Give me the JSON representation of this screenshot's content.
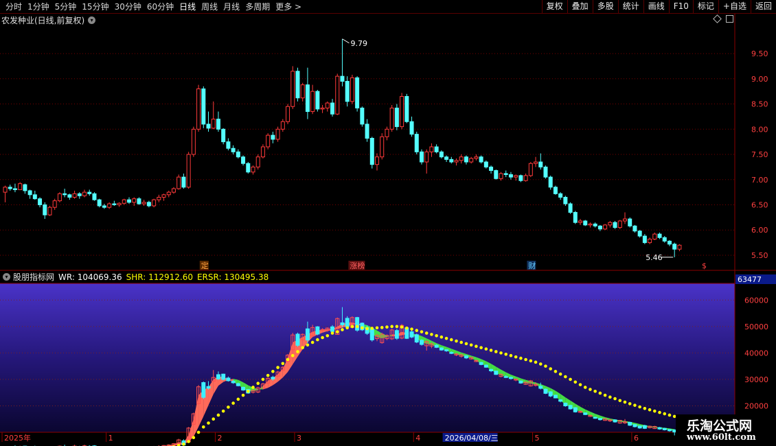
{
  "toolbar": {
    "periods": [
      "分时",
      "1分钟",
      "5分钟",
      "15分钟",
      "30分钟",
      "60分钟",
      "日线",
      "周线",
      "月线",
      "多周期",
      "更多"
    ],
    "active_period": "日线",
    "right_buttons": [
      "复权",
      "叠加",
      "多股",
      "统计",
      "画线",
      "F10",
      "标记",
      "+自选",
      "返回"
    ]
  },
  "main_pane": {
    "title": "农发种业(日线,前复权)",
    "high_label": "9.79",
    "low_label": "5.46",
    "events": [
      {
        "label": "定",
        "color": "#ffa040",
        "bg": "#5a2a00"
      },
      {
        "label": "涨榜",
        "color": "#ff6060",
        "bg": "#5a1010"
      },
      {
        "label": "财",
        "color": "#66ccff",
        "bg": "#10305a"
      },
      {
        "label": "$",
        "color": "#ff4040",
        "bg": "#000000"
      }
    ]
  },
  "indicator_pane": {
    "name": "股朋指标网",
    "wr_label": "WR: 104069.36",
    "shr_label": "SHR: 112912.60",
    "ersr_label": "ERSR: 130495.38",
    "current_value": "63477",
    "colors": {
      "wr": "#ffffff",
      "shr": "#ffff00",
      "ersr": "#ffff00"
    }
  },
  "x_axis": {
    "labels": [
      "2025年",
      "1",
      "2",
      "3",
      "4",
      "5",
      "6"
    ],
    "crosshair_date": "2026/04/08/三"
  },
  "watermark": {
    "cn": "乐淘公式网",
    "url": "www.60lt.com"
  },
  "chart_data": {
    "type": "candlestick",
    "title": "农发种业(日线,前复权)",
    "price_axis": {
      "ticks": [
        5.5,
        6.0,
        6.5,
        7.0,
        7.5,
        8.0,
        8.5,
        9.0,
        9.5
      ],
      "ylim": [
        5.35,
        9.95
      ]
    },
    "indicator_axis": {
      "ticks": [
        20000,
        30000,
        40000,
        50000,
        60000
      ],
      "ylim": [
        10000,
        65000
      ]
    },
    "annotations": {
      "high": 9.79,
      "low": 5.46
    },
    "ohlc": [
      [
        6.75,
        6.88,
        6.55,
        6.85
      ],
      [
        6.85,
        6.9,
        6.78,
        6.82
      ],
      [
        6.82,
        6.92,
        6.75,
        6.8
      ],
      [
        6.8,
        6.95,
        6.8,
        6.92
      ],
      [
        6.9,
        6.92,
        6.72,
        6.78
      ],
      [
        6.78,
        6.8,
        6.62,
        6.7
      ],
      [
        6.7,
        6.78,
        6.6,
        6.62
      ],
      [
        6.62,
        6.65,
        6.45,
        6.5
      ],
      [
        6.5,
        6.55,
        6.22,
        6.3
      ],
      [
        6.3,
        6.48,
        6.28,
        6.45
      ],
      [
        6.45,
        6.62,
        6.4,
        6.58
      ],
      [
        6.58,
        6.75,
        6.55,
        6.72
      ],
      [
        6.72,
        6.82,
        6.65,
        6.7
      ],
      [
        6.7,
        6.72,
        6.6,
        6.65
      ],
      [
        6.65,
        6.78,
        6.62,
        6.72
      ],
      [
        6.72,
        6.75,
        6.62,
        6.68
      ],
      [
        6.68,
        6.8,
        6.65,
        6.75
      ],
      [
        6.75,
        6.8,
        6.68,
        6.72
      ],
      [
        6.72,
        6.75,
        6.58,
        6.6
      ],
      [
        6.6,
        6.62,
        6.45,
        6.48
      ],
      [
        6.48,
        6.52,
        6.42,
        6.45
      ],
      [
        6.45,
        6.55,
        6.42,
        6.52
      ],
      [
        6.52,
        6.58,
        6.48,
        6.5
      ],
      [
        6.5,
        6.55,
        6.46,
        6.53
      ],
      [
        6.53,
        6.62,
        6.5,
        6.6
      ],
      [
        6.6,
        6.65,
        6.52,
        6.55
      ],
      [
        6.55,
        6.65,
        6.48,
        6.62
      ],
      [
        6.62,
        6.65,
        6.5,
        6.52
      ],
      [
        6.52,
        6.6,
        6.48,
        6.55
      ],
      [
        6.55,
        6.58,
        6.45,
        6.48
      ],
      [
        6.48,
        6.62,
        6.45,
        6.6
      ],
      [
        6.6,
        6.7,
        6.55,
        6.65
      ],
      [
        6.65,
        6.72,
        6.58,
        6.7
      ],
      [
        6.7,
        6.78,
        6.65,
        6.75
      ],
      [
        6.75,
        6.85,
        6.72,
        6.82
      ],
      [
        6.82,
        7.1,
        6.8,
        7.05
      ],
      [
        7.05,
        7.12,
        6.82,
        6.85
      ],
      [
        6.85,
        7.55,
        6.82,
        7.5
      ],
      [
        7.5,
        8.05,
        7.45,
        8.0
      ],
      [
        8.0,
        8.88,
        7.95,
        8.8
      ],
      [
        8.8,
        8.85,
        8.02,
        8.1
      ],
      [
        8.1,
        8.35,
        7.95,
        8.02
      ],
      [
        8.02,
        8.55,
        8.0,
        8.2
      ],
      [
        8.2,
        8.35,
        7.95,
        8.0
      ],
      [
        8.0,
        8.02,
        7.7,
        7.75
      ],
      [
        7.75,
        7.82,
        7.58,
        7.62
      ],
      [
        7.62,
        7.68,
        7.5,
        7.55
      ],
      [
        7.55,
        7.6,
        7.42,
        7.45
      ],
      [
        7.45,
        7.48,
        7.28,
        7.32
      ],
      [
        7.32,
        7.35,
        7.12,
        7.15
      ],
      [
        7.15,
        7.28,
        7.1,
        7.25
      ],
      [
        7.25,
        7.5,
        7.2,
        7.45
      ],
      [
        7.45,
        7.7,
        7.42,
        7.65
      ],
      [
        7.65,
        7.92,
        7.6,
        7.88
      ],
      [
        7.88,
        7.95,
        7.72,
        7.8
      ],
      [
        7.8,
        8.05,
        7.75,
        8.0
      ],
      [
        8.0,
        8.2,
        7.95,
        8.15
      ],
      [
        8.15,
        8.5,
        8.1,
        8.45
      ],
      [
        8.45,
        9.25,
        8.4,
        9.15
      ],
      [
        9.15,
        9.22,
        8.55,
        8.62
      ],
      [
        8.62,
        8.92,
        8.55,
        8.88
      ],
      [
        8.88,
        9.22,
        8.2,
        8.35
      ],
      [
        8.35,
        8.88,
        8.3,
        8.75
      ],
      [
        8.75,
        8.78,
        8.35,
        8.4
      ],
      [
        8.4,
        8.48,
        8.32,
        8.42
      ],
      [
        8.42,
        8.55,
        8.35,
        8.52
      ],
      [
        8.52,
        8.6,
        8.25,
        8.3
      ],
      [
        8.3,
        9.1,
        8.28,
        9.05
      ],
      [
        9.05,
        9.79,
        8.85,
        8.95
      ],
      [
        8.95,
        9.05,
        8.45,
        8.55
      ],
      [
        8.55,
        9.08,
        8.5,
        9.02
      ],
      [
        9.02,
        9.05,
        8.35,
        8.42
      ],
      [
        8.42,
        8.45,
        8.05,
        8.1
      ],
      [
        8.1,
        8.2,
        7.75,
        7.82
      ],
      [
        7.82,
        7.85,
        7.22,
        7.3
      ],
      [
        7.3,
        7.52,
        7.18,
        7.45
      ],
      [
        7.45,
        7.92,
        7.4,
        7.85
      ],
      [
        7.85,
        8.05,
        7.78,
        8.0
      ],
      [
        8.0,
        8.48,
        7.95,
        8.42
      ],
      [
        8.42,
        8.5,
        7.98,
        8.05
      ],
      [
        8.05,
        8.72,
        8.0,
        8.65
      ],
      [
        8.65,
        8.7,
        8.12,
        8.15
      ],
      [
        8.15,
        8.25,
        7.85,
        7.9
      ],
      [
        7.9,
        7.95,
        7.5,
        7.55
      ],
      [
        7.55,
        7.6,
        7.3,
        7.35
      ],
      [
        7.35,
        7.6,
        7.12,
        7.55
      ],
      [
        7.55,
        7.72,
        7.45,
        7.65
      ],
      [
        7.65,
        7.7,
        7.52,
        7.55
      ],
      [
        7.55,
        7.58,
        7.42,
        7.45
      ],
      [
        7.45,
        7.48,
        7.35,
        7.4
      ],
      [
        7.4,
        7.45,
        7.32,
        7.35
      ],
      [
        7.35,
        7.42,
        7.28,
        7.38
      ],
      [
        7.38,
        7.5,
        7.32,
        7.45
      ],
      [
        7.45,
        7.48,
        7.3,
        7.35
      ],
      [
        7.35,
        7.45,
        7.32,
        7.42
      ],
      [
        7.42,
        7.5,
        7.38,
        7.45
      ],
      [
        7.45,
        7.48,
        7.32,
        7.35
      ],
      [
        7.35,
        7.38,
        7.22,
        7.25
      ],
      [
        7.25,
        7.28,
        7.12,
        7.18
      ],
      [
        7.18,
        7.2,
        7.0,
        7.02
      ],
      [
        7.02,
        7.15,
        6.98,
        7.12
      ],
      [
        7.12,
        7.18,
        7.05,
        7.1
      ],
      [
        7.1,
        7.15,
        7.0,
        7.05
      ],
      [
        7.05,
        7.1,
        6.98,
        7.08
      ],
      [
        7.08,
        7.1,
        6.95,
        6.98
      ],
      [
        6.98,
        7.12,
        6.96,
        7.08
      ],
      [
        7.08,
        7.35,
        7.05,
        7.32
      ],
      [
        7.32,
        7.45,
        7.25,
        7.35
      ],
      [
        7.35,
        7.52,
        7.2,
        7.25
      ],
      [
        7.25,
        7.28,
        7.02,
        7.05
      ],
      [
        7.05,
        7.08,
        6.8,
        6.85
      ],
      [
        6.85,
        6.88,
        6.7,
        6.72
      ],
      [
        6.72,
        6.75,
        6.6,
        6.65
      ],
      [
        6.65,
        6.68,
        6.48,
        6.52
      ],
      [
        6.52,
        6.55,
        6.32,
        6.35
      ],
      [
        6.35,
        6.38,
        6.12,
        6.15
      ],
      [
        6.15,
        6.22,
        6.1,
        6.18
      ],
      [
        6.18,
        6.2,
        6.08,
        6.1
      ],
      [
        6.1,
        6.15,
        6.05,
        6.12
      ],
      [
        6.12,
        6.15,
        6.05,
        6.08
      ],
      [
        6.08,
        6.1,
        5.98,
        6.02
      ],
      [
        6.02,
        6.12,
        6.0,
        6.1
      ],
      [
        6.1,
        6.18,
        6.05,
        6.15
      ],
      [
        6.15,
        6.18,
        6.02,
        6.05
      ],
      [
        6.05,
        6.2,
        6.02,
        6.18
      ],
      [
        6.18,
        6.35,
        6.12,
        6.22
      ],
      [
        6.22,
        6.25,
        6.05,
        6.08
      ],
      [
        6.08,
        6.1,
        5.95,
        5.98
      ],
      [
        5.98,
        6.0,
        5.85,
        5.88
      ],
      [
        5.88,
        5.92,
        5.72,
        5.75
      ],
      [
        5.75,
        5.85,
        5.72,
        5.82
      ],
      [
        5.82,
        5.95,
        5.8,
        5.92
      ],
      [
        5.92,
        5.95,
        5.82,
        5.85
      ],
      [
        5.85,
        5.88,
        5.75,
        5.78
      ],
      [
        5.78,
        5.8,
        5.68,
        5.72
      ],
      [
        5.72,
        5.75,
        5.46,
        5.62
      ],
      [
        5.62,
        5.72,
        5.58,
        5.7
      ]
    ],
    "shr": [
      4,
      4,
      4.2,
      4.2,
      4.3,
      4.2,
      4,
      3.6,
      3.2,
      3.4,
      3.8,
      4.2,
      4.4,
      4.4,
      4.5,
      4.5,
      4.6,
      4.6,
      4.4,
      4,
      3.8,
      3.8,
      3.8,
      4,
      4.2,
      4.2,
      4.3,
      4.2,
      4.2,
      4,
      4.2,
      4.5,
      4.8,
      5,
      5.4,
      6.2,
      6,
      9,
      15,
      24,
      26,
      27,
      30,
      31,
      31,
      30,
      29,
      28,
      26.5,
      25.5,
      25.5,
      26,
      27.5,
      29.5,
      30.5,
      32,
      34,
      38,
      44,
      45,
      46,
      47,
      48,
      48.5,
      48.8,
      49,
      49,
      50,
      51,
      51.5,
      51.5,
      51,
      50,
      48.5,
      47,
      46,
      45.5,
      46,
      47,
      47,
      48,
      47.5,
      47,
      45.5,
      44,
      43.5,
      43,
      42.5,
      41.5,
      41,
      40,
      39.5,
      39,
      38.5,
      38,
      37,
      36,
      35,
      33.5,
      32.5,
      31.5,
      31,
      30.5,
      30,
      29,
      28.5,
      28.5,
      28,
      27,
      25.5,
      24.5,
      23.5,
      22,
      20.5,
      19.5,
      18.5,
      17.8,
      17,
      16.3,
      15.5,
      15,
      14.8,
      14.5,
      14.3,
      14,
      13.8,
      13.2,
      12.5,
      12,
      12,
      12,
      11.8,
      11.5,
      11.2,
      10.8,
      10.5
    ],
    "ersr": [
      3,
      3,
      3,
      3.1,
      3.2,
      3.2,
      3.2,
      3.1,
      3,
      3,
      3.1,
      3.2,
      3.3,
      3.4,
      3.5,
      3.6,
      3.7,
      3.8,
      3.8,
      3.8,
      3.7,
      3.7,
      3.7,
      3.7,
      3.8,
      3.8,
      3.9,
      3.9,
      3.9,
      3.9,
      3.9,
      4,
      4.1,
      4.3,
      4.5,
      5,
      5.5,
      6.5,
      8,
      10,
      12,
      13.5,
      15,
      16.5,
      18,
      19.5,
      21,
      22.5,
      24,
      25.5,
      27,
      28.5,
      30,
      31.5,
      33,
      34.5,
      36,
      37.5,
      39,
      40.5,
      42,
      43,
      44,
      45,
      45.8,
      46.5,
      47.5,
      48,
      48.8,
      49.5,
      50,
      50,
      49.5,
      49.2,
      49.3,
      49.5,
      49.6,
      49.8,
      50,
      50,
      49.8,
      49.4,
      49,
      48.5,
      48,
      47.5,
      47,
      46.5,
      46,
      45.5,
      45,
      44.5,
      44,
      43.5,
      43,
      42.5,
      42,
      41.5,
      41,
      40.5,
      40,
      39.5,
      39,
      38.5,
      38,
      37.5,
      37,
      36.5,
      35.8,
      35,
      34,
      33,
      32,
      31,
      30,
      29,
      28,
      27,
      26.2,
      25.5,
      24.8,
      24,
      23.3,
      22.7,
      22,
      21.4,
      20.8,
      20.2,
      19.6,
      19,
      18.5,
      18,
      17.5,
      17,
      16.5,
      16,
      15.6
    ]
  }
}
